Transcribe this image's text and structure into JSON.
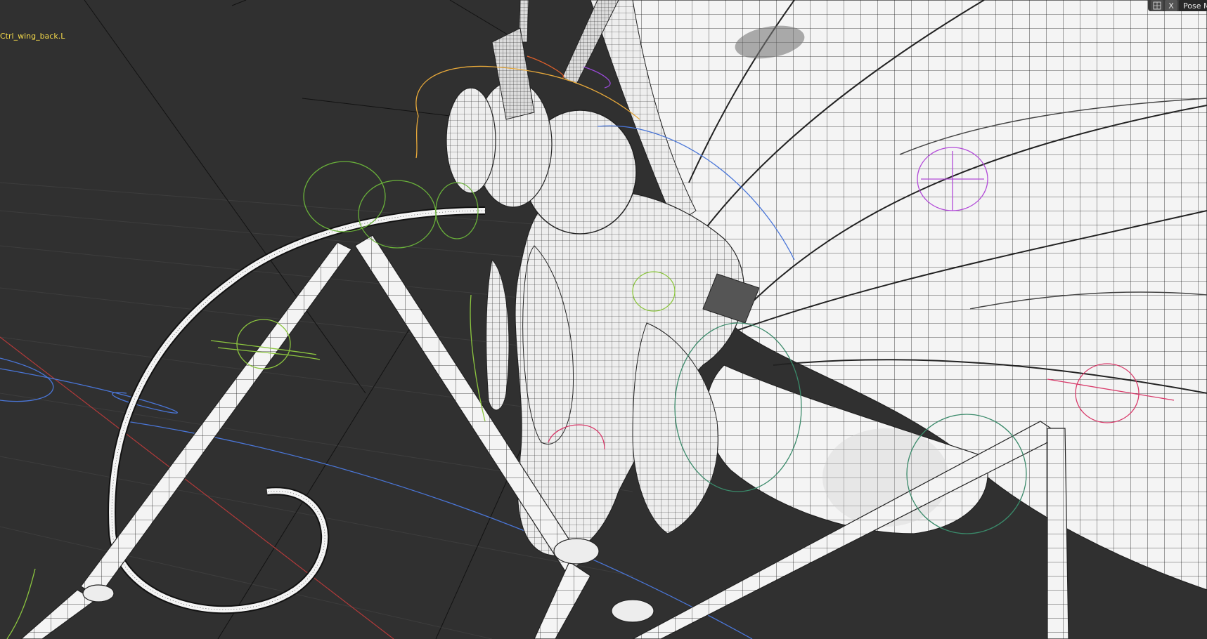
{
  "viewport": {
    "active_object_name": "Ctrl_wing_back.L",
    "background_color": "#303030",
    "text_color_active": "#f2d84a"
  },
  "header": {
    "snap_icon": "snap-icon",
    "axis_x_label": "X",
    "mode_label": "Pose M"
  }
}
